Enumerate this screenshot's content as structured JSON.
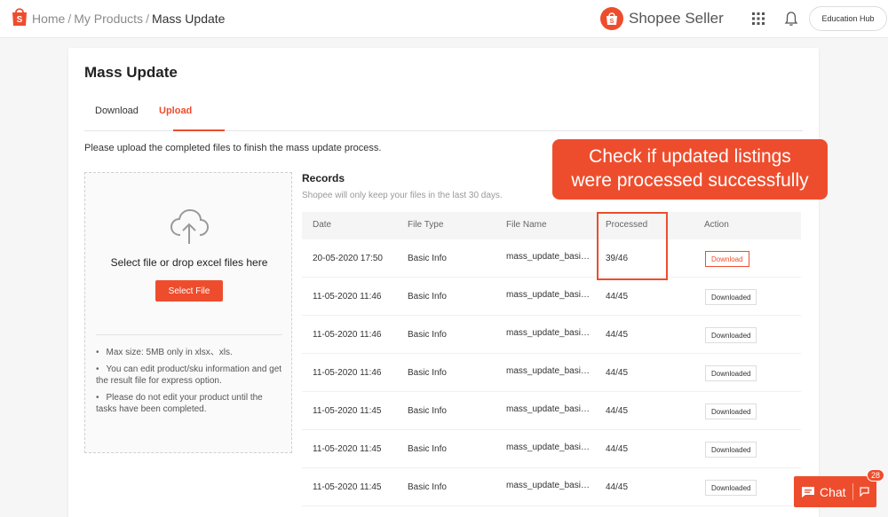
{
  "breadcrumb": {
    "home": "Home",
    "products": "My Products",
    "current": "Mass Update",
    "separator": "/"
  },
  "brand": {
    "name": "Shopee Seller"
  },
  "topbar": {
    "education_hub": "Education Hub"
  },
  "page": {
    "title": "Mass Update",
    "tabs": [
      {
        "label": "Download"
      },
      {
        "label": "Upload"
      }
    ],
    "active_tab": "Upload",
    "instruction": "Please upload the completed files to finish the mass update process."
  },
  "upload": {
    "drop_text": "Select file or drop excel files here",
    "select_button": "Select File",
    "notes": [
      "Max size: 5MB only in xlsx、xls.",
      "You can edit product/sku information and get the result file for express option.",
      "Please do not edit your product until the tasks have been completed."
    ]
  },
  "records": {
    "title": "Records",
    "subtitle": "Shopee will only keep your files in the last 30 days.",
    "columns": [
      "Date",
      "File Type",
      "File Name",
      "Processed",
      "Action"
    ],
    "rows": [
      {
        "date": "20-05-2020 17:50",
        "type": "Basic Info",
        "name": "mass_update_basic_info",
        "processed": "39/46",
        "action": "Download"
      },
      {
        "date": "11-05-2020 11:46",
        "type": "Basic Info",
        "name": "mass_update_basic_info",
        "processed": "44/45",
        "action": "Downloaded"
      },
      {
        "date": "11-05-2020 11:46",
        "type": "Basic Info",
        "name": "mass_update_basic_info",
        "processed": "44/45",
        "action": "Downloaded"
      },
      {
        "date": "11-05-2020 11:46",
        "type": "Basic Info",
        "name": "mass_update_basic_info",
        "processed": "44/45",
        "action": "Downloaded"
      },
      {
        "date": "11-05-2020 11:45",
        "type": "Basic Info",
        "name": "mass_update_basic_info",
        "processed": "44/45",
        "action": "Downloaded"
      },
      {
        "date": "11-05-2020 11:45",
        "type": "Basic Info",
        "name": "mass_update_basic_info",
        "processed": "44/45",
        "action": "Downloaded"
      },
      {
        "date": "11-05-2020 11:45",
        "type": "Basic Info",
        "name": "mass_update_basic_info",
        "processed": "44/45",
        "action": "Downloaded"
      }
    ]
  },
  "callout": {
    "line1": "Check if updated listings",
    "line2": "were processed successfully"
  },
  "chat": {
    "label": "Chat",
    "badge": "28"
  },
  "icons": {
    "logo": "shopee-bag-icon",
    "apps": "grid-icon",
    "notifications": "bell-icon",
    "upload": "cloud-upload-icon",
    "chat": "chat-bubble-icon",
    "expand": "expand-icon"
  },
  "colors": {
    "brand": "#ee4d2d"
  }
}
